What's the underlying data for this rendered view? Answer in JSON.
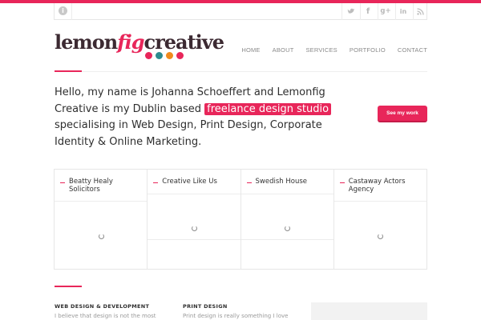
{
  "topbar": {
    "social": [
      "twitter-icon",
      "facebook-icon",
      "google-plus-icon",
      "linkedin-icon",
      "rss-icon"
    ]
  },
  "logo": {
    "part1": "lemon",
    "part2": "fig",
    "part3": "creative",
    "dot_colors": [
      "#e8265a",
      "#2d8b8e",
      "#f08a1c",
      "#e8265a"
    ]
  },
  "nav": {
    "items": [
      "HOME",
      "ABOUT",
      "SERVICES",
      "PORTFOLIO",
      "CONTACT"
    ]
  },
  "intro": {
    "before": "Hello, my name is Johanna Schoeffert and Lemonfig Creative is my Dublin based ",
    "highlight": "freelance design studio",
    "after": " specialising in Web Design, Print Design, Corporate Identity & Online Marketing."
  },
  "cta": {
    "label": "See my work"
  },
  "portfolio": [
    {
      "title": "Beatty Healy Solicitors"
    },
    {
      "title": "Creative Like Us"
    },
    {
      "title": "Swedish House"
    },
    {
      "title": "Castaway Actors Agency"
    }
  ],
  "columns": [
    {
      "title": "WEB DESIGN & DEVELOPMENT",
      "text": "I believe that design is not the most"
    },
    {
      "title": "PRINT DESIGN",
      "text": "Print design is really something I love"
    }
  ],
  "colors": {
    "accent": "#e8265a",
    "text": "#2e2e2e",
    "muted": "#8a8a8a"
  }
}
